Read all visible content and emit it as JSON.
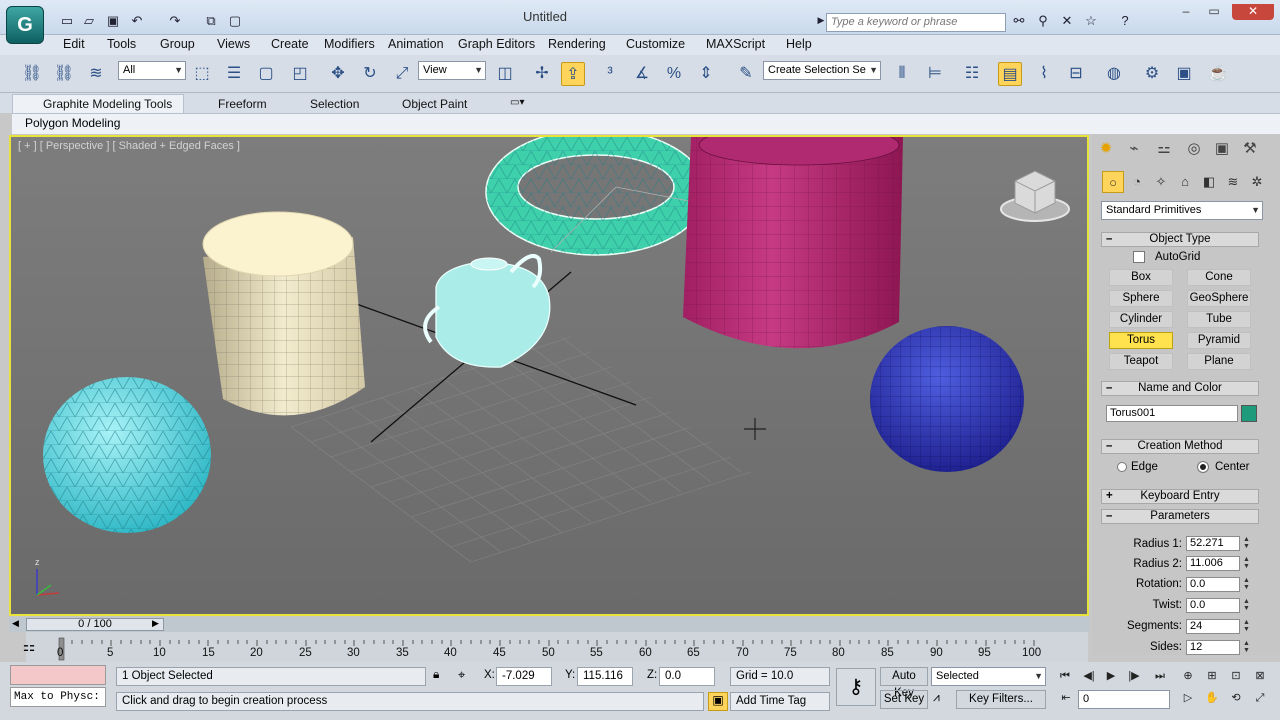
{
  "window": {
    "title": "Untitled",
    "search_placeholder": "Type a keyword or phrase"
  },
  "menu": [
    "Edit",
    "Tools",
    "Group",
    "Views",
    "Create",
    "Modifiers",
    "Animation",
    "Graph Editors",
    "Rendering",
    "Customize",
    "MAXScript",
    "Help"
  ],
  "toolbar": {
    "selection_filter": "All",
    "ref_coord": "View",
    "named_selection": "Create Selection Se"
  },
  "ribbon": {
    "tabs": [
      "Graphite Modeling Tools",
      "Freeform",
      "Selection",
      "Object Paint"
    ],
    "panel_label": "Polygon Modeling"
  },
  "viewport": {
    "label": "[ + ] [ Perspective ] [ Shaded + Edged Faces ]",
    "axis_z": "z"
  },
  "command_panel": {
    "category": "Standard Primitives",
    "object_type": {
      "title": "Object Type",
      "autogrid": "AutoGrid",
      "buttons": [
        "Box",
        "Cone",
        "Sphere",
        "GeoSphere",
        "Cylinder",
        "Tube",
        "Torus",
        "Pyramid",
        "Teapot",
        "Plane"
      ],
      "selected": "Torus"
    },
    "name_color": {
      "title": "Name and Color",
      "name": "Torus001",
      "color": "#1e9b7a"
    },
    "creation_method": {
      "title": "Creation Method",
      "options": [
        "Edge",
        "Center"
      ],
      "selected": "Center"
    },
    "keyboard_entry": {
      "title": "Keyboard Entry"
    },
    "parameters": {
      "title": "Parameters",
      "fields": [
        {
          "label": "Radius 1:",
          "value": "52.271"
        },
        {
          "label": "Radius 2:",
          "value": "11.006"
        },
        {
          "label": "Rotation:",
          "value": "0.0"
        },
        {
          "label": "Twist:",
          "value": "0.0"
        },
        {
          "label": "Segments:",
          "value": "24"
        },
        {
          "label": "Sides:",
          "value": "12"
        }
      ]
    }
  },
  "timeline": {
    "frame": "0 / 100",
    "ticks": [
      "5",
      "10",
      "15",
      "20",
      "25",
      "30",
      "35",
      "40",
      "45",
      "50",
      "55",
      "60",
      "65",
      "70",
      "75",
      "80",
      "85",
      "90",
      "95",
      "100"
    ],
    "first_tick": "0"
  },
  "status": {
    "maxscript": "Max to Physc:",
    "selection": "1 Object Selected",
    "prompt": "Click and drag to begin creation process",
    "x_label": "X:",
    "x": "-7.029",
    "y_label": "Y:",
    "y": "115.116",
    "z_label": "Z:",
    "z": "0.0",
    "grid": "Grid = 10.0",
    "add_time_tag": "Add Time Tag",
    "auto_key": "Auto Key",
    "set_key": "Set Key",
    "key_mode": "Selected",
    "key_filters": "Key Filters...",
    "current_frame": "0"
  }
}
